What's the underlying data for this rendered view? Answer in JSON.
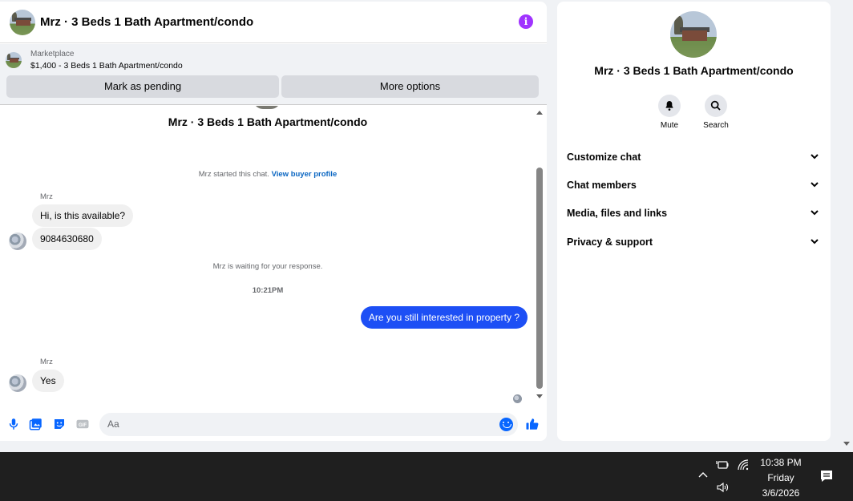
{
  "chat": {
    "header_title": "Mrz · 3 Beds 1 Bath Apartment/condo",
    "info_icon_glyph": "i",
    "marketplace": {
      "label": "Marketplace",
      "listing": "$1,400 - 3 Beds 1 Bath Apartment/condo"
    },
    "buttons": {
      "mark_pending": "Mark as pending",
      "more_options": "More options"
    },
    "thread_title": "Mrz · 3 Beds 1 Bath Apartment/condo",
    "started_text": "Mrz started this chat.",
    "view_profile": "View buyer profile",
    "sender_name_1": "Mrz",
    "message_1": "Hi, is this available?",
    "message_2": "9084630680",
    "waiting_text": "Mrz is waiting for your response.",
    "timestamp": "10:21PM",
    "outgoing_message": "Are you still interested in property ?",
    "sender_name_2": "Mrz",
    "message_3": "Yes",
    "composer_placeholder": "Aa",
    "composer_icons": [
      "microphone-icon",
      "image-icon",
      "sticker-icon",
      "gif-icon",
      "emoji-icon",
      "thumbs-up-icon"
    ]
  },
  "info_panel": {
    "title": "Mrz · 3 Beds 1 Bath Apartment/condo",
    "actions": [
      {
        "label": "Mute",
        "icon": "bell-icon"
      },
      {
        "label": "Search",
        "icon": "search-icon"
      }
    ],
    "sections": [
      "Customize chat",
      "Chat members",
      "Media, files and links",
      "Privacy & support"
    ]
  },
  "taskbar": {
    "time": "10:38 PM",
    "day": "Friday",
    "date": "3/6/2026",
    "icons": [
      "chevron-up-icon",
      "battery-icon",
      "wifi-icon",
      "volume-icon",
      "notifications-icon"
    ]
  },
  "colors": {
    "accent": "#0866ff",
    "outgoing_bubble": "#1d4ff5",
    "info_purple": "#a033ff",
    "taskbar": "#1f1f1f"
  }
}
